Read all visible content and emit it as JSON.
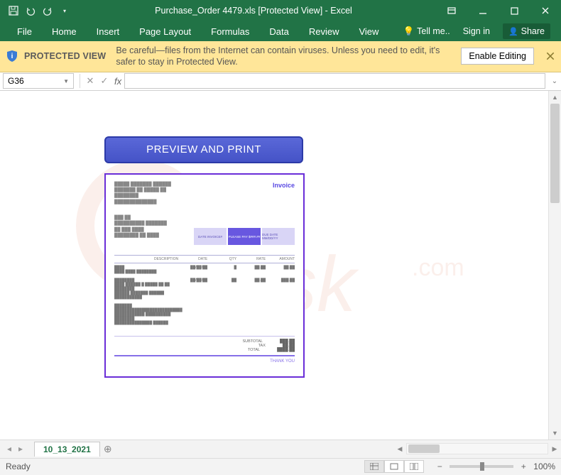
{
  "title": "Purchase_Order 4479.xls  [Protected View] - Excel",
  "ribbon_tabs": [
    "File",
    "Home",
    "Insert",
    "Page Layout",
    "Formulas",
    "Data",
    "Review",
    "View"
  ],
  "ribbon_right": {
    "tell_me": "Tell me..",
    "sign_in": "Sign in",
    "share": "Share"
  },
  "protected_view": {
    "title": "PROTECTED VIEW",
    "message": "Be careful—files from the Internet can contain viruses. Unless you need to edit, it's safer to stay in Protected View.",
    "button": "Enable Editing"
  },
  "namebox": "G36",
  "sheet": {
    "preview_button": "PREVIEW AND PRINT",
    "invoice": {
      "title": "Invoice",
      "pay_boxes": [
        "DATE\nINVOICE#",
        "PLEASE PAY\n$###.##",
        "DUE DATE\nMM/DD/YY"
      ],
      "headers": [
        "DESCRIPTION",
        "DATE",
        "QTY",
        "RATE",
        "AMOUNT"
      ],
      "totals": {
        "subtotal": "SUBTOTAL",
        "tax": "TAX",
        "total": "TOTAL"
      },
      "thank_you": "THANK YOU"
    }
  },
  "sheet_tab": "10_13_2021",
  "status": {
    "ready": "Ready",
    "zoom": "100%"
  }
}
